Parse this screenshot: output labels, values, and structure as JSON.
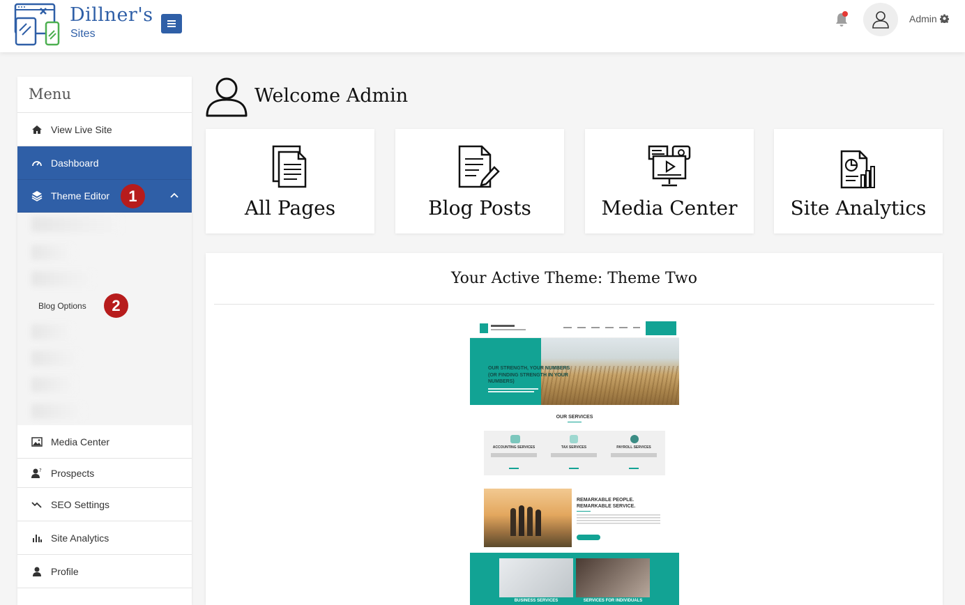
{
  "brand": {
    "name": "Dillner's",
    "subtitle": "Sites",
    "primary_color": "#2f5fa7"
  },
  "header": {
    "menu_toggle_icon": "hamburger-icon",
    "notification_icon": "bell-icon",
    "avatar_icon": "user-icon",
    "user_label": "Admin",
    "settings_icon": "gear-icon"
  },
  "sidebar": {
    "title": "Menu",
    "items": [
      {
        "label": "View Live Site",
        "icon": "home-icon"
      },
      {
        "label": "Dashboard",
        "icon": "speedometer-icon",
        "active": true
      },
      {
        "label": "Theme Editor",
        "icon": "layers-icon",
        "active": true,
        "expanded": true,
        "badge": "1"
      },
      {
        "label": "Media Center",
        "icon": "image-icon"
      },
      {
        "label": "Prospects",
        "icon": "user-question-icon"
      },
      {
        "label": "SEO Settings",
        "icon": "trend-icon"
      },
      {
        "label": "Site Analytics",
        "icon": "bar-chart-icon"
      },
      {
        "label": "Profile",
        "icon": "user-icon"
      }
    ],
    "submenu": {
      "visible_item": "Blog Options",
      "visible_item_badge": "2"
    }
  },
  "main": {
    "welcome": "Welcome Admin",
    "cards": [
      {
        "label": "All Pages",
        "icon": "documents-icon"
      },
      {
        "label": "Blog Posts",
        "icon": "document-edit-icon"
      },
      {
        "label": "Media Center",
        "icon": "media-monitor-icon"
      },
      {
        "label": "Site Analytics",
        "icon": "analytics-report-icon"
      }
    ],
    "theme": {
      "title": "Your Active Theme: Theme Two",
      "preview": {
        "hero_heading_1": "OUR STRENGTH, YOUR NUMBERS",
        "hero_heading_2": "(OR FINDING STRENGTH IN YOUR NUMBERS)",
        "services_heading": "OUR SERVICES",
        "service_1": "ACCOUNTING SERVICES",
        "service_2": "TAX SERVICES",
        "service_3": "PAYROLL SERVICES",
        "people_heading_1": "REMARKABLE PEOPLE.",
        "people_heading_2": "REMARKABLE SERVICE.",
        "bottom_1": "BUSINESS SERVICES",
        "bottom_2": "SERVICES FOR INDIVIDUALS",
        "accent_color": "#12a394"
      }
    }
  }
}
